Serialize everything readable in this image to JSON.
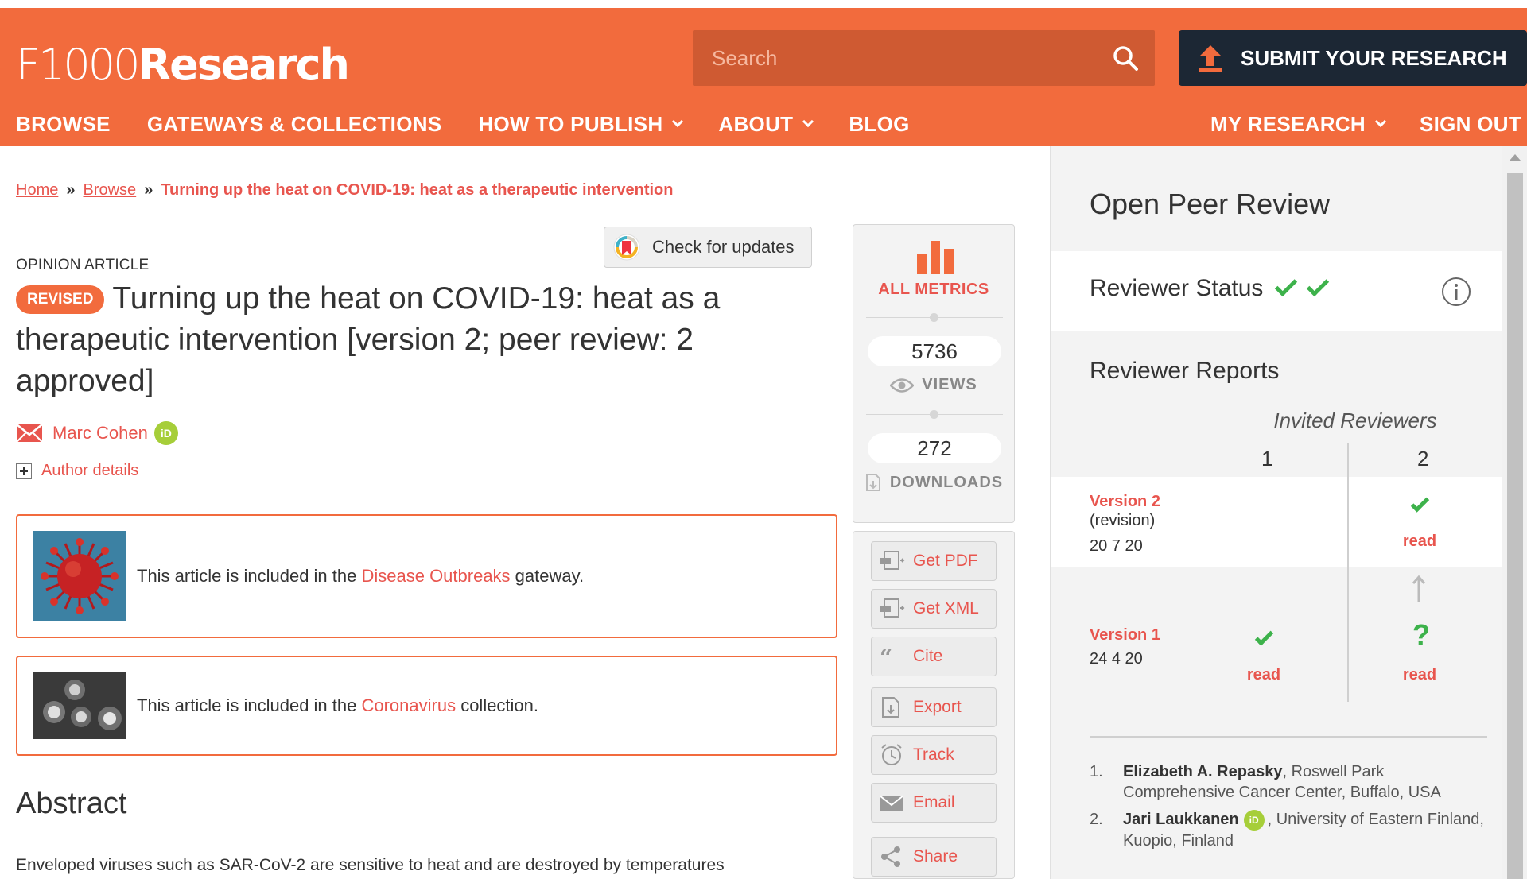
{
  "header": {
    "logo_prefix": "F1000",
    "logo_suffix": "Research",
    "search_placeholder": "Search",
    "submit_label": "SUBMIT YOUR RESEARCH",
    "accent_color": "#f26b3d",
    "dark_color": "#1c2734"
  },
  "nav": {
    "items": [
      {
        "label": "BROWSE"
      },
      {
        "label": "GATEWAYS & COLLECTIONS"
      },
      {
        "label": "HOW TO PUBLISH"
      },
      {
        "label": "ABOUT"
      },
      {
        "label": "BLOG"
      },
      {
        "label": "MY RESEARCH"
      },
      {
        "label": "SIGN OUT"
      }
    ]
  },
  "breadcrumb": {
    "home": "Home",
    "browse": "Browse",
    "separator": "»",
    "current": "Turning up the heat on COVID-19: heat as a therapeutic intervention"
  },
  "article": {
    "check_updates": "Check for updates",
    "type": "OPINION ARTICLE",
    "badge": "REVISED",
    "title": "Turning up the heat on COVID-19: heat as a therapeutic intervention [version 2; peer review: 2 approved]",
    "author": "Marc Cohen",
    "orcid_label": "iD",
    "author_details": "Author details",
    "gateway": {
      "prefix": "This article is included in the ",
      "link": "Disease Outbreaks",
      "suffix": " gateway."
    },
    "collection": {
      "prefix": "This article is included in the ",
      "link": "Coronavirus",
      "suffix": " collection."
    },
    "abstract_heading": "Abstract",
    "abstract_text": "Enveloped viruses such as SAR-CoV-2 are sensitive to heat and are destroyed by temperatures"
  },
  "metrics": {
    "all_metrics": "ALL METRICS",
    "views_count": "5736",
    "views_label": "VIEWS",
    "downloads_count": "272",
    "downloads_label": "DOWNLOADS"
  },
  "tools": [
    {
      "label": "Get PDF",
      "icon": "pdf-icon"
    },
    {
      "label": "Get XML",
      "icon": "xml-icon"
    },
    {
      "label": "Cite",
      "icon": "quote-icon"
    },
    {
      "label": "Export",
      "icon": "export-icon"
    },
    {
      "label": "Track",
      "icon": "alarm-clock-icon"
    },
    {
      "label": "Email",
      "icon": "mail-icon"
    },
    {
      "label": "Share",
      "icon": "share-icon"
    }
  ],
  "peer_review": {
    "title": "Open Peer Review",
    "status_label": "Reviewer Status",
    "reports_title": "Reviewer Reports",
    "invited_label": "Invited Reviewers",
    "col1": "1",
    "col2": "2",
    "version2": {
      "label": "Version 2",
      "note": "(revision)",
      "date": "20 7 20",
      "r2": "read"
    },
    "version1": {
      "label": "Version 1",
      "date": "24 4 20",
      "r1": "read",
      "r2": "read"
    },
    "reviewers": [
      {
        "num": "1.",
        "name": "Elizabeth A. Repasky",
        "affiliation": ", Roswell Park Comprehensive Cancer Center, Buffalo, USA"
      },
      {
        "num": "2.",
        "name": "Jari Laukkanen",
        "affiliation": ", University of Eastern Finland, Kuopio, Finland"
      }
    ],
    "approved_color": "#3db24b"
  }
}
